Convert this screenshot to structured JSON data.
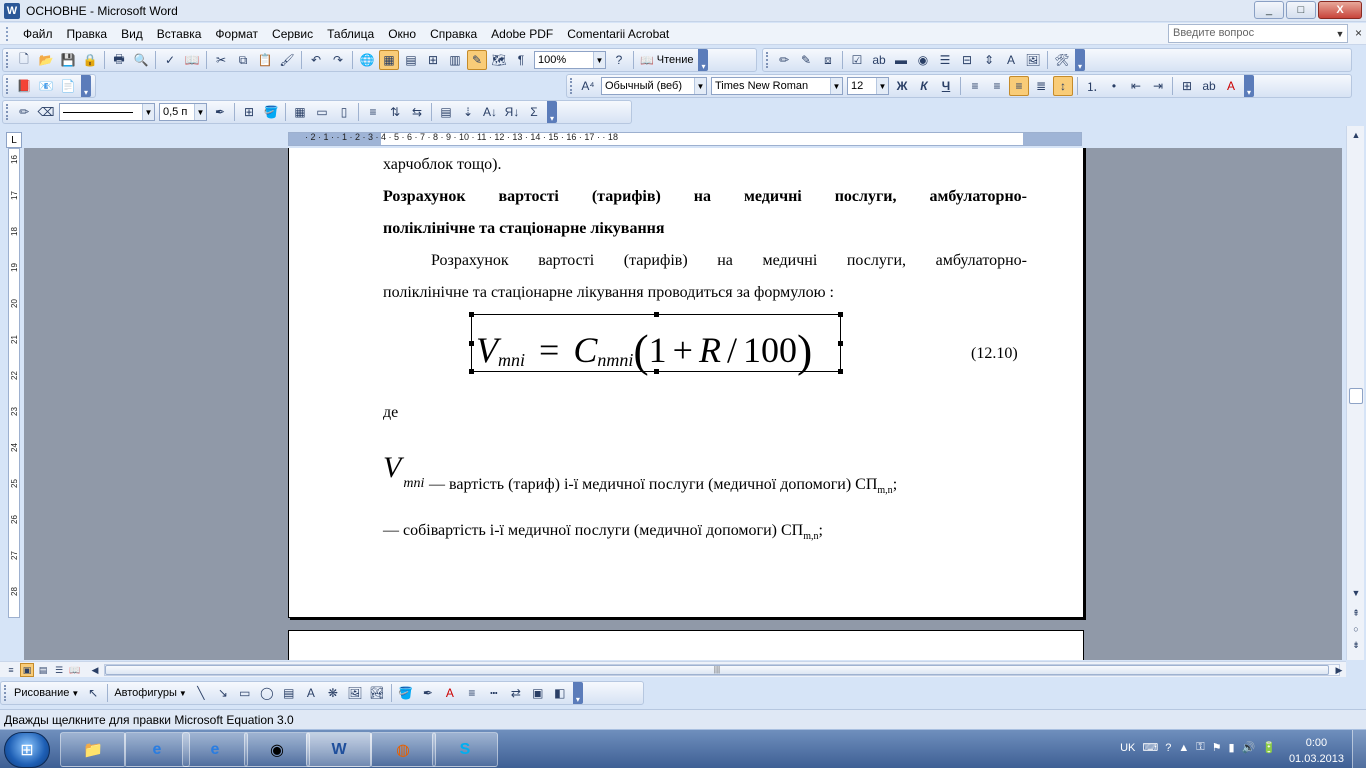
{
  "window": {
    "title": "ОСНОВНЕ - Microsoft Word",
    "minimize": "_",
    "maximize": "□",
    "close": "X"
  },
  "menu": {
    "items": [
      "Файл",
      "Правка",
      "Вид",
      "Вставка",
      "Формат",
      "Сервис",
      "Таблица",
      "Окно",
      "Справка",
      "Adobe PDF",
      "Comentarii Acrobat"
    ],
    "ask_placeholder": "Введите вопрос",
    "close_doc": "×"
  },
  "toolbar_standard": {
    "zoom": "100%",
    "read_label": "Чтение"
  },
  "toolbar_format": {
    "style": "Обычный (веб)",
    "font": "Times New Roman",
    "size": "12"
  },
  "toolbar_borders": {
    "line_width": "0,5 п"
  },
  "ruler": {
    "numbers": "· 2 · 1 ·   · 1 · 2 · 3 · 4 · 5 · 6 · 7 · 8 · 9 · 10 · 11 · 12 · 13 · 14 · 15 · 16 · 17 ·  · 18",
    "vnums": [
      "16",
      "17",
      "18",
      "19",
      "20",
      "21",
      "22",
      "23",
      "24",
      "25",
      "26",
      "27",
      "28"
    ]
  },
  "document": {
    "line1": "харчоблок тощо).",
    "heading_line1": "Розрахунок вартості (тарифів) на медичні послуги, амбулаторно-",
    "heading_line2": "поліклінічне та стаціонарне лікування",
    "para_line1": "Розрахунок вартості (тарифів) на медичні послуги, амбулаторно-",
    "para_line2": "поліклінічне та стаціонарне лікування проводиться за формулою :",
    "formula": {
      "lhs": "V",
      "lhs_sub": "mni",
      "eq": "=",
      "c": "C",
      "c_sub": "nmni",
      "open": "(",
      "one": "1",
      "plus": "+",
      "r": "R",
      "slash": "/",
      "hundred": "100",
      "close": ")"
    },
    "eq_number": "(12.10)",
    "where": "де",
    "def1_symbol": "V",
    "def1_symbol_sub": "mni",
    "def1_text": "— вартість (тариф) і-ї медичної послуги (медичної допомоги) СП",
    "def1_sub": "m,n",
    "def1_end": ";",
    "def2_text": "— собівартість і-ї медичної послуги (медичної допомоги) СП",
    "def2_sub": "m,n",
    "def2_end": ";"
  },
  "drawing": {
    "draw_label": "Рисование",
    "autoshapes_label": "Автофигуры"
  },
  "status": {
    "text": "Дважды щелкните для правки Microsoft Equation 3.0"
  },
  "taskbar": {
    "lang": "UK",
    "time": "0:00",
    "date": "01.03.2013"
  }
}
